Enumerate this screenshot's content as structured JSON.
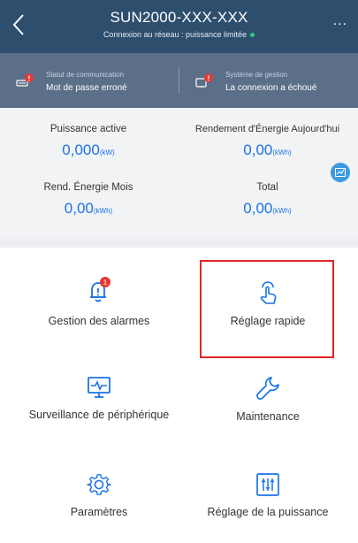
{
  "header": {
    "title": "SUN2000-XXX-XXX",
    "subtitle": "Connexion au réseau : puissance limitée",
    "status_dot_color": "#2ecc71",
    "more_label": "..."
  },
  "status": {
    "communication_label": "Statut de communication",
    "communication_value": "Mot de passe erroné",
    "management_label": "Système de gestion",
    "management_value": "La connexion a échoué"
  },
  "energy": {
    "active_power_label": "Puissance active",
    "active_power_value": "0,000",
    "active_power_unit": "(kW)",
    "today_yield_label": "Rendement d'Énergie Aujourd'hui",
    "today_yield_value": "0,00",
    "today_yield_unit": "(kWh)",
    "month_yield_label": "Rend. Énergie Mois",
    "month_yield_value": "0,00",
    "month_yield_unit": "(kWh)",
    "total_label": "Total",
    "total_value": "0,00",
    "total_unit": "(kWh)"
  },
  "functions": {
    "alarms_label": "Gestion des alarmes",
    "alarms_badge": "1",
    "quick_setup_label": "Réglage rapide",
    "device_monitoring_label": "Surveillance de périphérique",
    "maintenance_label": "Maintenance",
    "settings_label": "Paramètres",
    "power_adjustment_label": "Réglage de la puissance"
  },
  "colors": {
    "header_bg": "#2e4e6e",
    "status_bg": "#5b6f88",
    "accent": "#1a73e8",
    "highlight": "#e02626",
    "alert_red": "#e53935"
  },
  "icons": {
    "back": "chevron-left-icon",
    "more": "more-icon",
    "communication": "communication-error-icon",
    "management": "management-system-error-icon",
    "chart": "chart-icon",
    "alarms": "bell-icon",
    "quick_setup": "tap-hand-icon",
    "device_monitoring": "monitor-icon",
    "maintenance": "wrench-icon",
    "settings": "gear-icon",
    "power_adjustment": "sliders-icon"
  }
}
